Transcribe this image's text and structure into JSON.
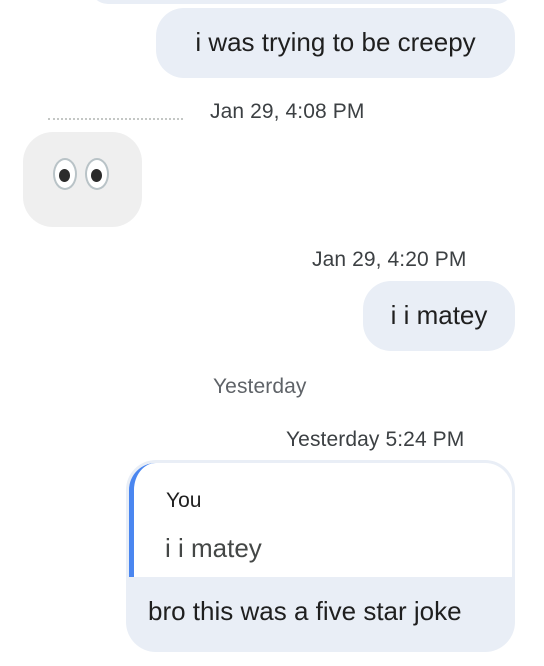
{
  "messages": [
    {
      "text": "i was trying to be creepy"
    },
    {
      "timestamp": "Jan 29, 4:08 PM",
      "emoji_name": "eyes-emoji"
    },
    {
      "timestamp": "Jan 29, 4:20 PM",
      "text": "i i matey"
    }
  ],
  "day_divider": "Yesterday",
  "reply_message": {
    "timestamp": "Yesterday 5:24 PM",
    "quoted_author": "You",
    "quoted_text": "i i matey",
    "text": "bro this was a five star joke"
  },
  "colors": {
    "outgoing_bubble": "#e9eef6",
    "incoming_bubble": "#efefef",
    "quote_accent": "#4a86f0",
    "timestamp_text": "#5f6368"
  }
}
